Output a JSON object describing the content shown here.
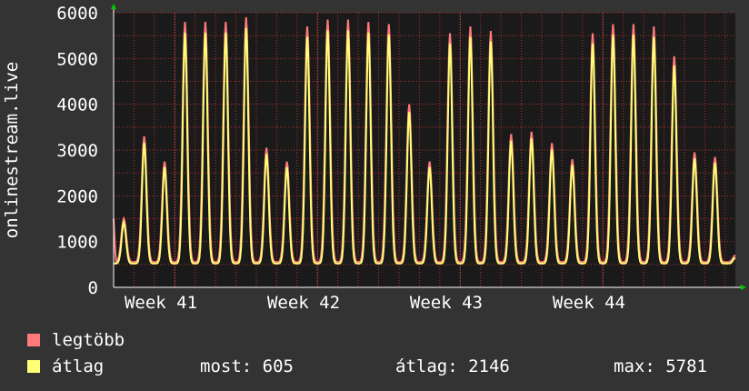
{
  "chart_data": {
    "type": "area",
    "ylabel": "onlinestream.live",
    "ylim": [
      0,
      6000
    ],
    "y_ticks": [
      0,
      1000,
      2000,
      3000,
      4000,
      5000,
      6000
    ],
    "x_ticks": [
      "Week 41",
      "Week 42",
      "Week 43",
      "Week 44"
    ],
    "grid": true,
    "x_unit": "day",
    "daily_peaks": [
      1500,
      3300,
      2750,
      5800,
      5800,
      5800,
      5900,
      3050,
      2750,
      5700,
      5850,
      5850,
      5800,
      5750,
      4000,
      2750,
      5550,
      5700,
      5600,
      3350,
      3400,
      3150,
      2800,
      5550,
      5750,
      5750,
      5700,
      5050,
      2950,
      2850,
      700
    ],
    "series": [
      {
        "name": "legtöbb",
        "color": "#ff7a7a",
        "description": "max"
      },
      {
        "name": "átlag",
        "color": "#ffff77",
        "description": "average"
      }
    ]
  },
  "legend": {
    "max_label": "legtöbb",
    "avg_label": "átlag",
    "now_text": "most: 605",
    "avg_text": "átlag: 2146",
    "max_text": "max: 5781"
  },
  "colors": {
    "background": "#333333",
    "plot_background": "#1a1a1a",
    "grid": "#b03030",
    "axis": "#ffffff",
    "arrow": "#00cc00"
  }
}
